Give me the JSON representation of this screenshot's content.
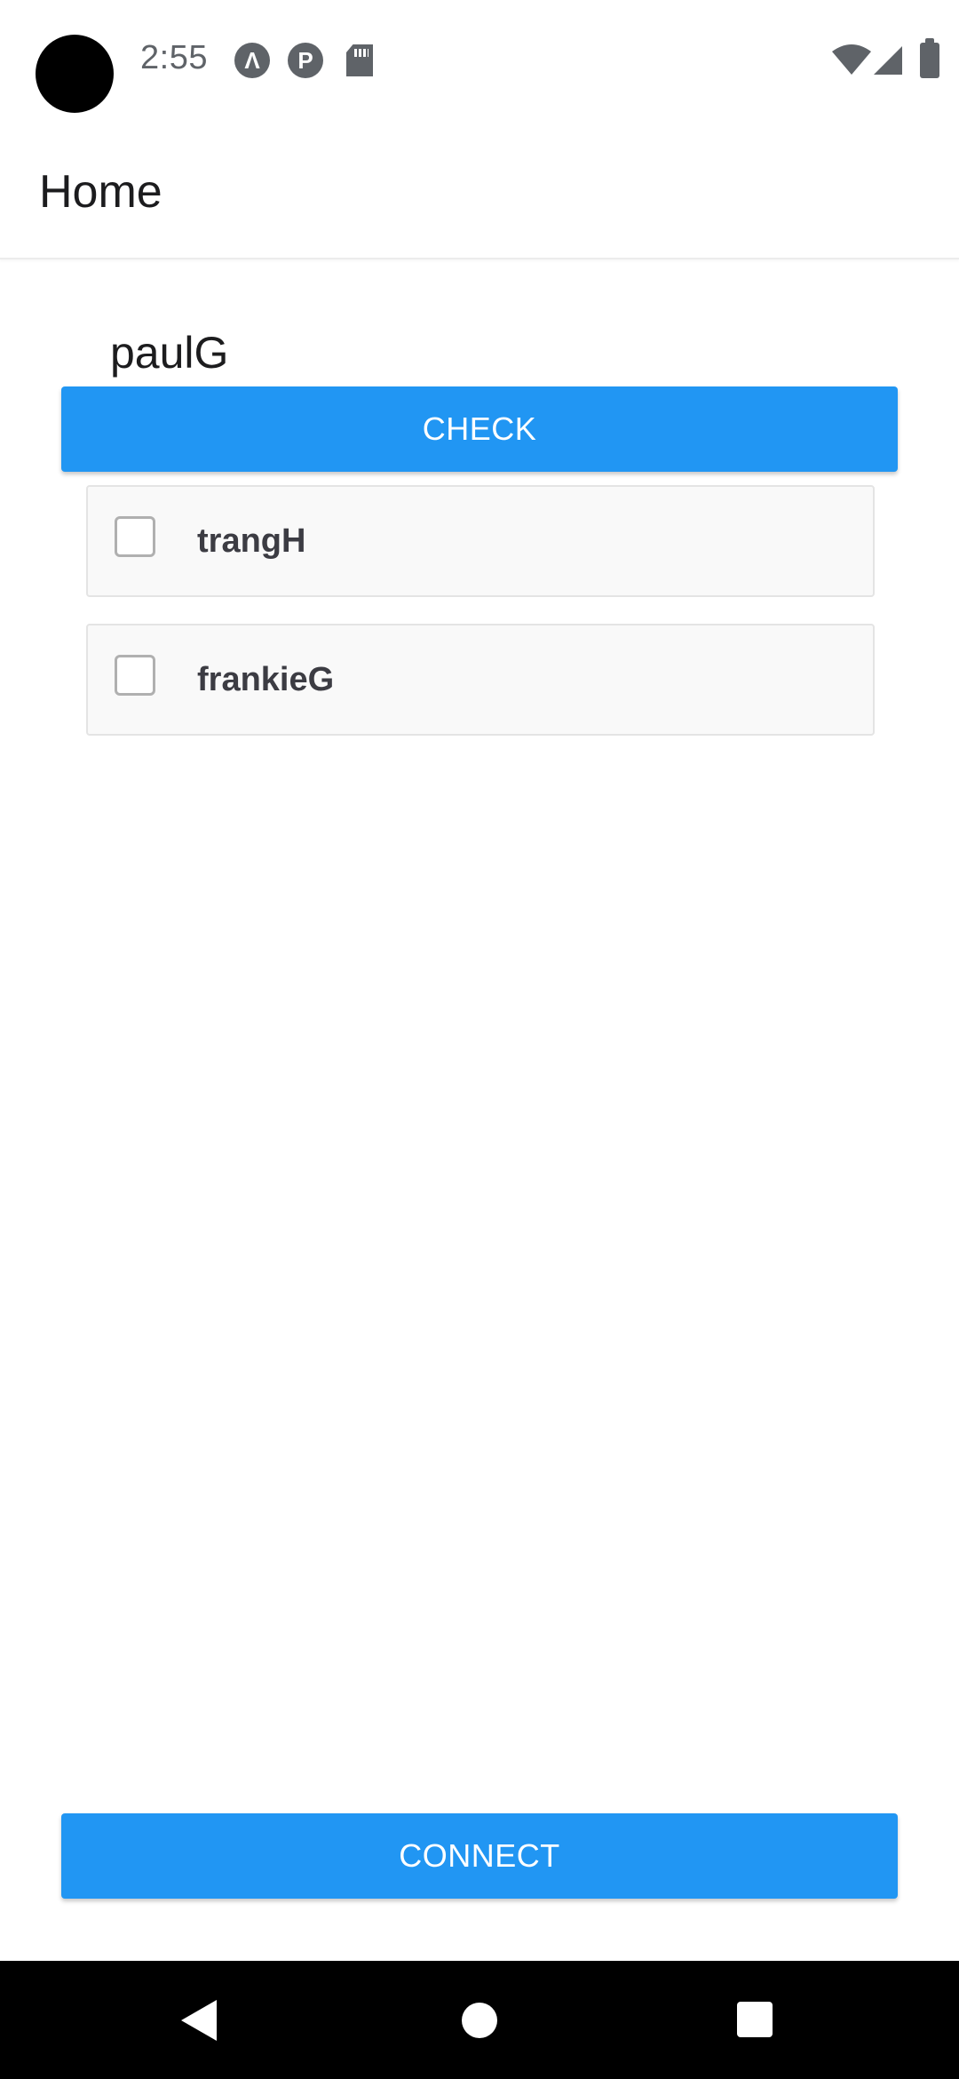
{
  "status_bar": {
    "time": "2:55",
    "icons": [
      "notification-a-icon",
      "notification-p-icon",
      "sd-card-icon",
      "wifi-icon",
      "signal-icon",
      "battery-icon"
    ],
    "notification_a_glyph": "Λ",
    "notification_p_glyph": "P"
  },
  "app_bar": {
    "title": "Home"
  },
  "main": {
    "username": "paulG",
    "check_button_label": "CHECK",
    "list_items": [
      {
        "label": "trangH",
        "checked": false
      },
      {
        "label": "frankieG",
        "checked": false
      }
    ],
    "connect_button_label": "CONNECT"
  },
  "colors": {
    "accent": "#2196f3",
    "nav_bar": "#000000",
    "list_item_bg": "#f9f9f9"
  },
  "nav_bar": {
    "buttons": [
      "back-icon",
      "home-icon",
      "recents-icon"
    ]
  }
}
